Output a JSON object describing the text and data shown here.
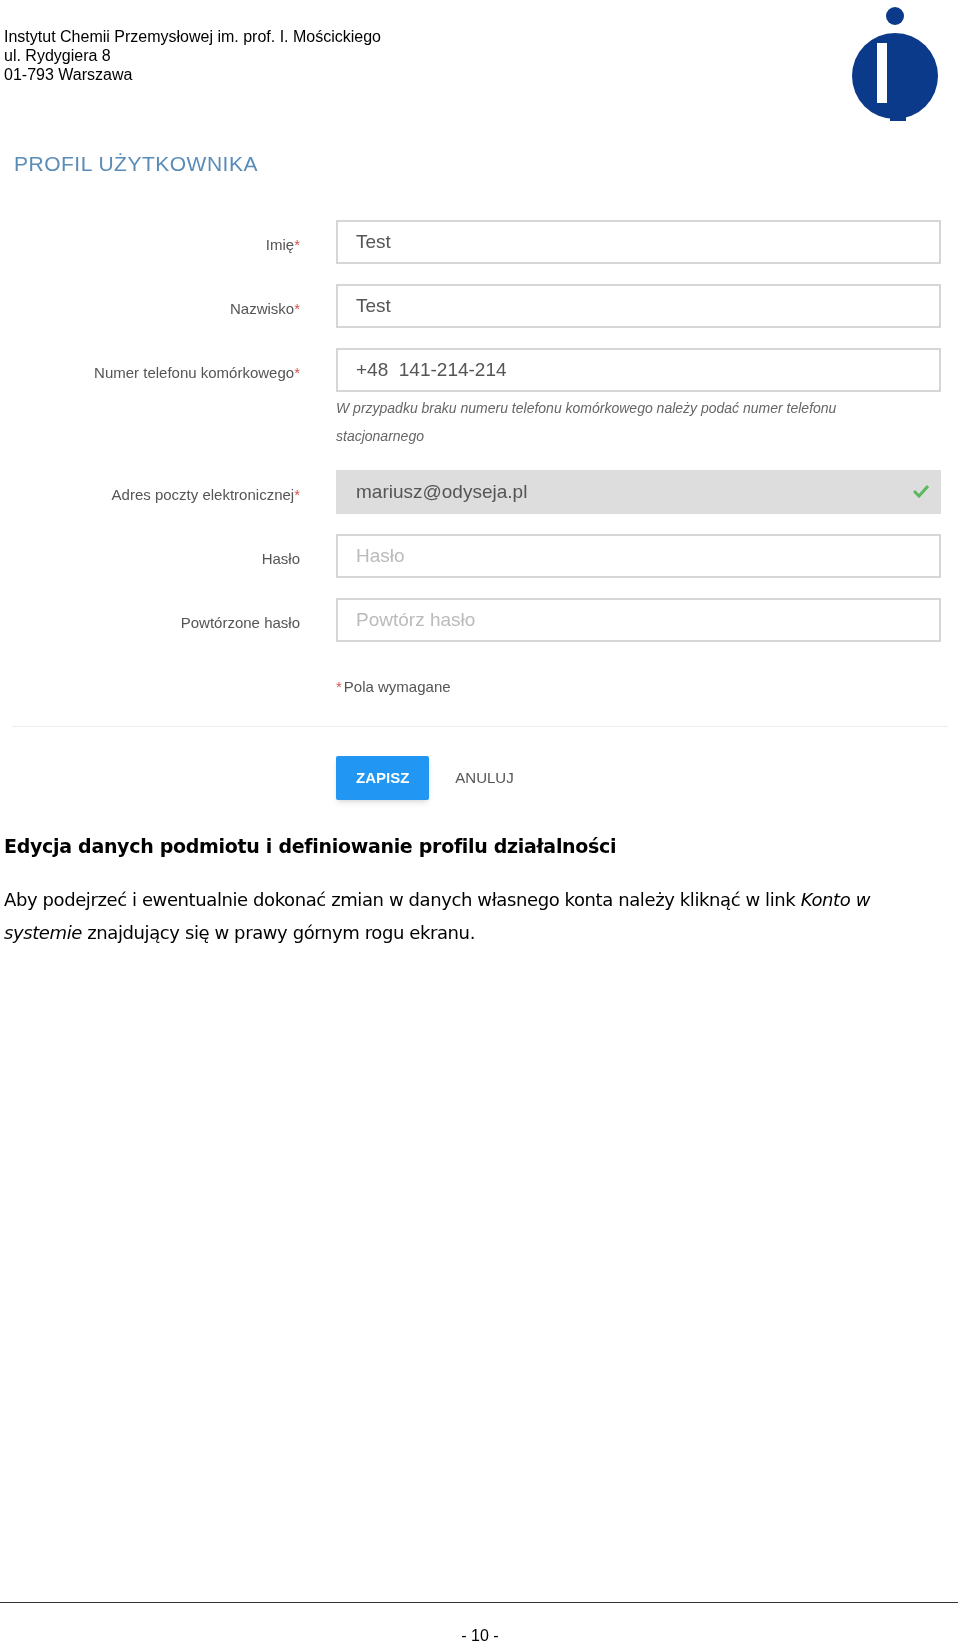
{
  "header": {
    "lines": [
      "Instytut Chemii Przemysłowej im. prof. I. Mościckiego",
      "ul. Rydygiera 8",
      "01-793 Warszawa"
    ]
  },
  "form": {
    "title": "PROFIL UŻYTKOWNIKA",
    "fields": [
      {
        "label": "Imię",
        "required": true,
        "value": "Test",
        "disabled": false,
        "valid": false
      },
      {
        "label": "Nazwisko",
        "required": true,
        "value": "Test",
        "disabled": false,
        "valid": false
      },
      {
        "label": "Numer telefonu komórkowego",
        "required": true,
        "value": "+48  141-214-214",
        "hint": "W przypadku braku numeru telefonu komórkowego należy podać numer telefonu stacjonarnego",
        "disabled": false,
        "valid": false
      },
      {
        "label": "Adres poczty elektronicznej",
        "required": true,
        "value": "mariusz@odyseja.pl",
        "disabled": true,
        "valid": true
      },
      {
        "label": "Hasło",
        "required": false,
        "placeholder": "Hasło",
        "disabled": false,
        "valid": false
      },
      {
        "label": "Powtórzone hasło",
        "required": false,
        "placeholder": "Powtórz hasło",
        "disabled": false,
        "valid": false
      }
    ],
    "required_mark": "*",
    "required_note": "Pola wymagane",
    "buttons": [
      {
        "label": "ZAPISZ",
        "kind": "primary"
      },
      {
        "label": "ANULUJ",
        "kind": "flat"
      }
    ]
  },
  "section_heading": "Edycja danych podmiotu i definiowanie profilu działalności",
  "paragraph": "Aby podejrzeć i ewentualnie dokonać zmian w danych własnego konta należy kliknąć w link *Konto w systemie* znajdujący się w prawy górnym rogu ekranu.",
  "footer": {
    "page_number": "- 10 -"
  }
}
